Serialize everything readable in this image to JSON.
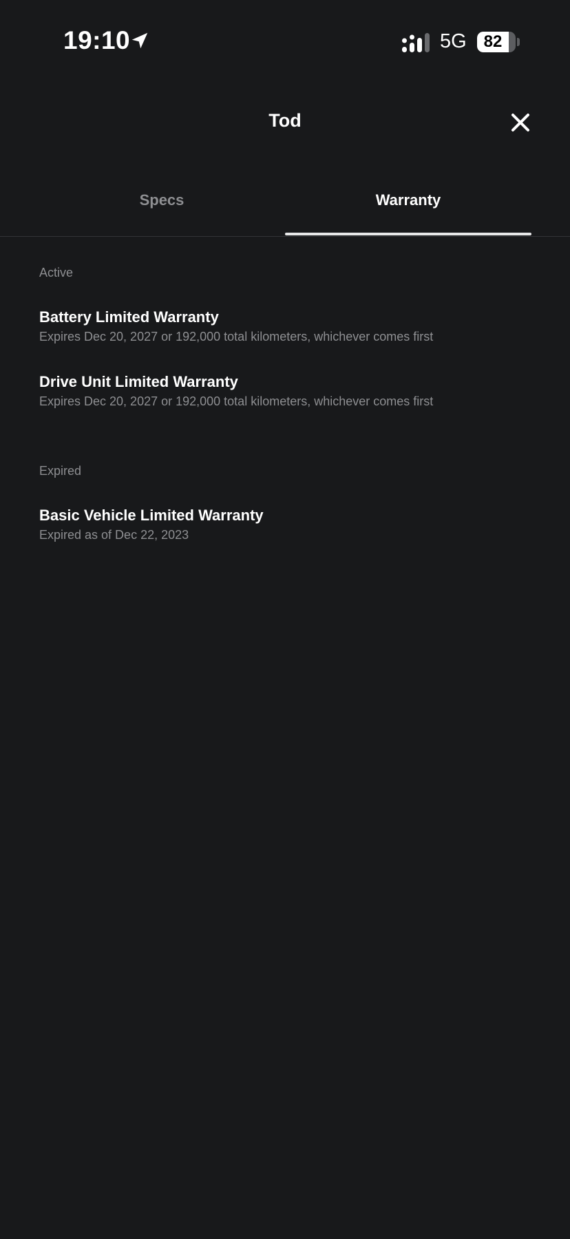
{
  "status_bar": {
    "time": "19:10",
    "network": "5G",
    "battery_level": "82",
    "battery_fraction": 0.82
  },
  "header": {
    "title": "Tod"
  },
  "tabs": [
    {
      "label": "Specs",
      "active": false
    },
    {
      "label": "Warranty",
      "active": true
    }
  ],
  "sections": {
    "active": {
      "label": "Active",
      "items": [
        {
          "title": "Battery Limited Warranty",
          "subtitle": "Expires Dec 20, 2027 or 192,000 total kilometers, whichever comes first"
        },
        {
          "title": "Drive Unit Limited Warranty",
          "subtitle": "Expires Dec 20, 2027 or 192,000 total kilometers, whichever comes first"
        }
      ]
    },
    "expired": {
      "label": "Expired",
      "items": [
        {
          "title": "Basic Vehicle Limited Warranty",
          "subtitle": "Expired as of Dec 22, 2023"
        }
      ]
    }
  },
  "colors": {
    "background": "#18191b",
    "primary_text": "#ffffff",
    "secondary_text": "#8e8f92",
    "tab_indicator": "#e8e8e9"
  },
  "icons": {
    "location": "location-arrow-icon",
    "signal": "cellular-signal-icon",
    "close": "close-icon"
  }
}
